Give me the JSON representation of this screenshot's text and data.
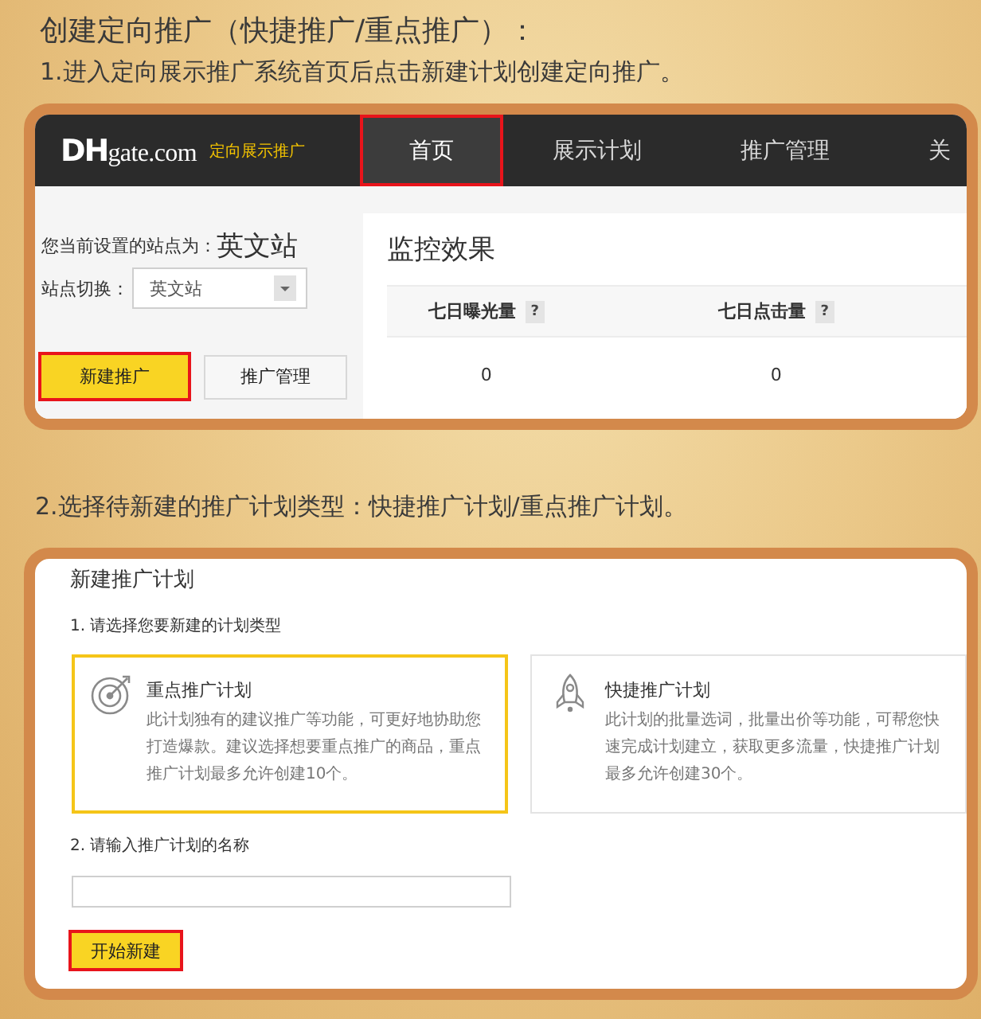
{
  "heading": "创建定向推广（快捷推广/重点推广）：",
  "step_1": {
    "text": "1.进入定向展示推广系统首页后点击新建计划创建定向推广。",
    "dashboard": {
      "logo": "**DH**gate.com",
      "logo_tagline": "定向展示推广",
      "nav": [
        {
          "label": "首页",
          "selected": true,
          "highlighted": true
        },
        {
          "label": "展示计划",
          "selected": false,
          "highlighted": false
        },
        {
          "label": "推广管理",
          "selected": false,
          "highlighted": false
        },
        {
          "label": "关",
          "selected": false,
          "highlighted": false
        }
      ],
      "site_label": "您当前设置的站点为：",
      "site_value": "英文站",
      "switch_label": "站点切换：",
      "switch_value": "英文站",
      "buttons": [
        {
          "label": "新建推广",
          "kind": "primary",
          "highlighted": true
        },
        {
          "label": "推广管理",
          "kind": "secondary",
          "highlighted": false
        }
      ],
      "monitor": {
        "title": "监控效果",
        "columns": [
          {
            "label": "七日曝光量",
            "help": "?",
            "value": "0"
          },
          {
            "label": "七日点击量",
            "help": "?",
            "value": "0"
          }
        ]
      }
    }
  },
  "step_2": {
    "text": "2.选择待新建的推广计划类型：快捷推广计划/重点推广计划。",
    "dialog": {
      "title": "新建推广计划",
      "type_label": "1. 请选择您要新建的计划类型",
      "plan_types": [
        {
          "kind": "target",
          "title": "重点推广计划",
          "description": "此计划独有的建议推广等功能，可更好地协助您打造爆款。建议选择想要重点推广的商品，重点推广计划最多允许创建10个。",
          "selected": true
        },
        {
          "kind": "rocket",
          "title": "快捷推广计划",
          "description": "此计划的批量选词，批量出价等功能，可帮您快速完成计划建立，获取更多流量，快捷推广计划最多允许创建30个。",
          "selected": false
        }
      ],
      "name_label": "2. 请输入推广计划的名称",
      "submit": {
        "label": "开始新建",
        "highlighted": true
      }
    }
  }
}
